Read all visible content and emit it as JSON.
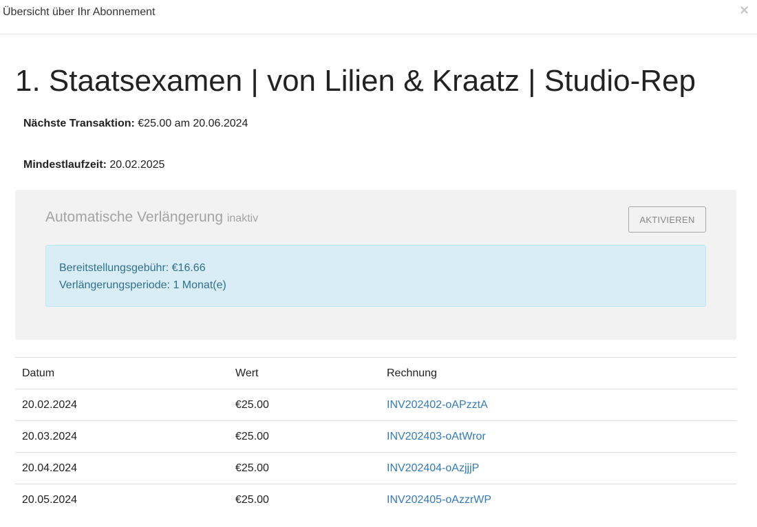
{
  "modal": {
    "title": "Übersicht über Ihr Abonnement",
    "close_glyph": "×"
  },
  "subscription": {
    "name": "1. Staatsexamen | von Lilien & Kraatz | Studio-Rep",
    "next_transaction_label": "Nächste Transaktion:",
    "next_transaction_value": "€25.00 am 20.06.2024",
    "min_term_label": "Mindestlaufzeit:",
    "min_term_value": "20.02.2025"
  },
  "renewal": {
    "title": "Automatische Verlängerung",
    "status": "inaktiv",
    "activate_label": "AKTIVIEREN",
    "fee_line": "Bereitstellungsgebühr: €16.66",
    "period_line": "Verlängerungsperiode: 1 Monat(e)"
  },
  "table": {
    "headers": [
      "Datum",
      "Wert",
      "Rechnung"
    ],
    "rows": [
      {
        "date": "20.02.2024",
        "value": "€25.00",
        "invoice": "INV202402-oAPzztA"
      },
      {
        "date": "20.03.2024",
        "value": "€25.00",
        "invoice": "INV202403-oAtWror"
      },
      {
        "date": "20.04.2024",
        "value": "€25.00",
        "invoice": "INV202404-oAzjjjP"
      },
      {
        "date": "20.05.2024",
        "value": "€25.00",
        "invoice": "INV202405-oAzzrWP"
      }
    ]
  },
  "colors": {
    "link": "#337ab7",
    "info_bg": "#d9edf7",
    "info_text": "#31708f",
    "panel_bg": "#f2f2f2"
  }
}
